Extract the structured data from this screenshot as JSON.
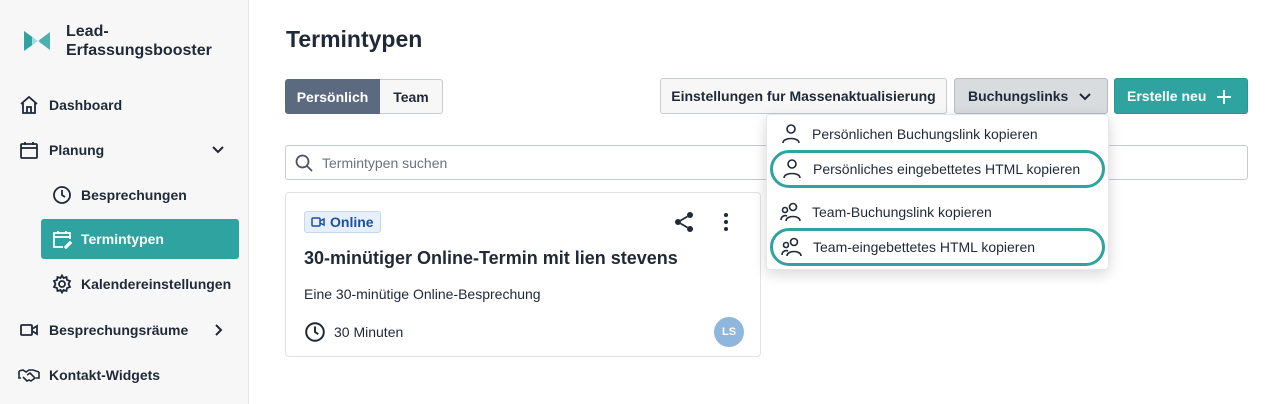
{
  "brand": {
    "line1": "Lead-",
    "line2": "Erfassungsbooster"
  },
  "sidebar": {
    "items": [
      {
        "label": "Dashboard"
      },
      {
        "label": "Planung"
      },
      {
        "label": "Besprechungen"
      },
      {
        "label": "Termintypen"
      },
      {
        "label": "Kalendereinstellungen"
      },
      {
        "label": "Besprechungsräume"
      },
      {
        "label": "Kontakt-Widgets"
      }
    ]
  },
  "page": {
    "title": "Termintypen"
  },
  "tabs": {
    "personal": "Persönlich",
    "team": "Team"
  },
  "toolbar": {
    "mass_update": "Einstellungen fur Massenaktualisierung",
    "booking_links": "Buchungslinks",
    "create_new": "Erstelle neu"
  },
  "search": {
    "placeholder": "Termintypen suchen"
  },
  "card": {
    "badge": "Online",
    "title": "30-minütiger Online-Termin mit lien stevens",
    "description": "Eine 30-minütige Online-Besprechung",
    "duration": "30 Minuten",
    "avatar": "LS"
  },
  "dropdown": {
    "items": [
      {
        "label": "Persönlichen Buchungslink kopieren",
        "icon": "person-icon"
      },
      {
        "label": "Persönliches eingebettetes HTML kopieren",
        "icon": "person-icon"
      },
      {
        "label": "Team-Buchungslink kopieren",
        "icon": "team-icon"
      },
      {
        "label": "Team-eingebettetes HTML kopieren",
        "icon": "team-icon"
      }
    ]
  },
  "colors": {
    "accent": "#2fa39f",
    "tab_active": "#5c6a80",
    "badge_text": "#1e4f9c"
  }
}
